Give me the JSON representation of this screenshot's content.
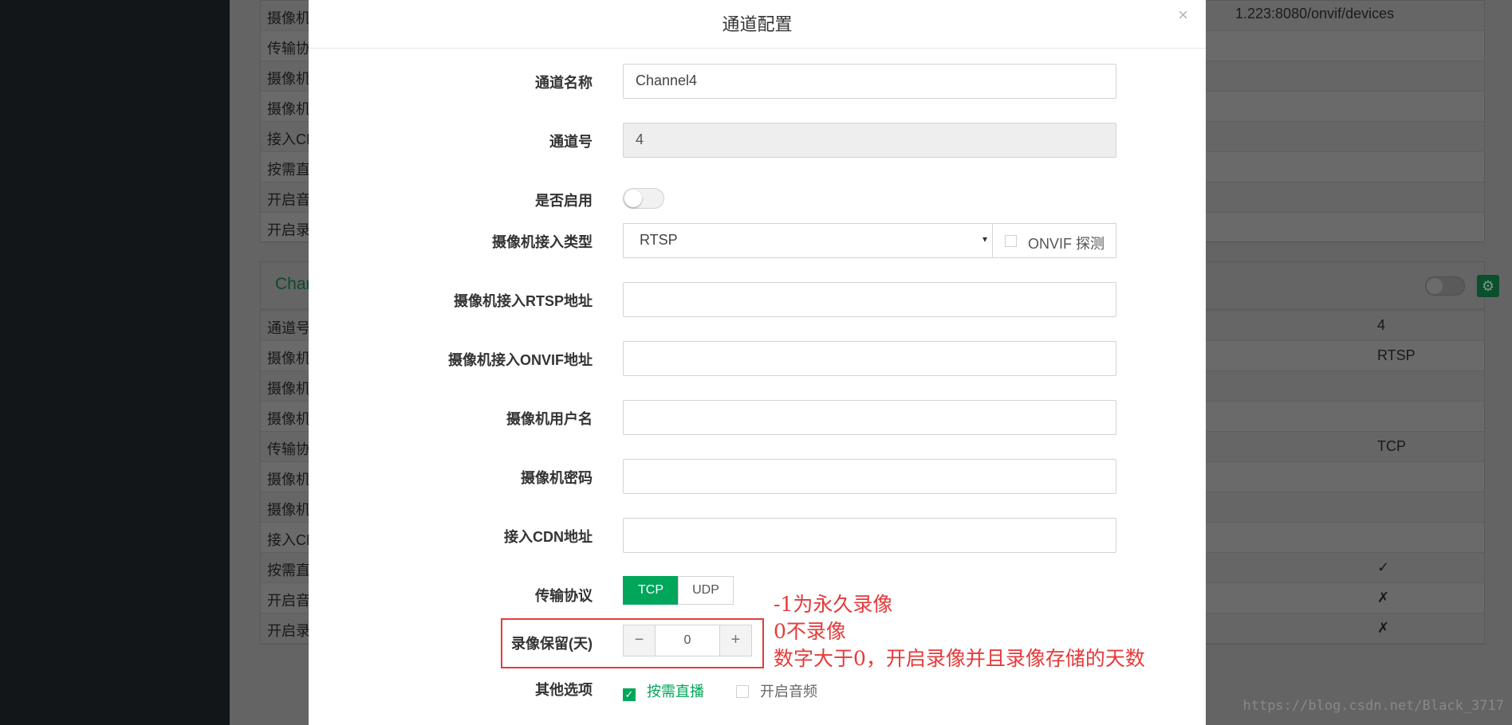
{
  "background": {
    "top_rows": [
      {
        "label": "摄像机",
        "value": ""
      },
      {
        "label": "传输协",
        "value": ""
      },
      {
        "label": "摄像机",
        "value": ""
      },
      {
        "label": "摄像机",
        "value": ""
      },
      {
        "label": "接入CD",
        "value": ""
      },
      {
        "label": "按需直",
        "value": ""
      },
      {
        "label": "开启音",
        "value": ""
      },
      {
        "label": "开启录",
        "value": ""
      }
    ],
    "url_fragment": "1.223:8080/onvif/devices",
    "panel_title": "Chan",
    "bottom_rows": [
      {
        "label": "通道号",
        "value": "4"
      },
      {
        "label": "摄像机",
        "value": "RTSP"
      },
      {
        "label": "摄像机",
        "value": ""
      },
      {
        "label": "摄像机",
        "value": ""
      },
      {
        "label": "传输协",
        "value": "TCP"
      },
      {
        "label": "摄像机",
        "value": ""
      },
      {
        "label": "摄像机",
        "value": ""
      },
      {
        "label": "接入CD",
        "value": ""
      },
      {
        "label": "按需直",
        "value": "✓"
      },
      {
        "label": "开启音",
        "value": "✗"
      },
      {
        "label": "开启录",
        "value": "✗"
      }
    ]
  },
  "modal": {
    "title": "通道配置",
    "close_icon": "×",
    "fields": {
      "channel_name": {
        "label": "通道名称",
        "value": "Channel4"
      },
      "channel_no": {
        "label": "通道号",
        "value": "4"
      },
      "enabled": {
        "label": "是否启用",
        "on": false
      },
      "access_type": {
        "label": "摄像机接入类型",
        "selected": "RTSP",
        "arrow": "▾",
        "onvif_label": "ONVIF 探测"
      },
      "rtsp_url": {
        "label": "摄像机接入RTSP地址",
        "value": ""
      },
      "onvif_url": {
        "label": "摄像机接入ONVIF地址",
        "value": ""
      },
      "username": {
        "label": "摄像机用户名",
        "value": ""
      },
      "password": {
        "label": "摄像机密码",
        "value": ""
      },
      "cdn_url": {
        "label": "接入CDN地址",
        "value": ""
      },
      "protocol": {
        "label": "传输协议",
        "options": [
          "TCP",
          "UDP"
        ],
        "selected": "TCP"
      },
      "record_days": {
        "label": "录像保留(天)",
        "value": "0",
        "minus": "−",
        "plus": "+"
      },
      "other": {
        "label": "其他选项",
        "on_demand_label": "按需直播",
        "on_demand_checked": true,
        "audio_label": "开启音频",
        "audio_checked": false,
        "check_mark": "✓"
      }
    }
  },
  "annotation": {
    "line1": "-1为永久录像",
    "line2": "0不录像",
    "line3": "数字大于0，开启录像并且录像存储的天数"
  },
  "watermark": "https://blog.csdn.net/Black_3717",
  "colors": {
    "accent": "#00a65a",
    "annotation": "#e53a3a"
  }
}
